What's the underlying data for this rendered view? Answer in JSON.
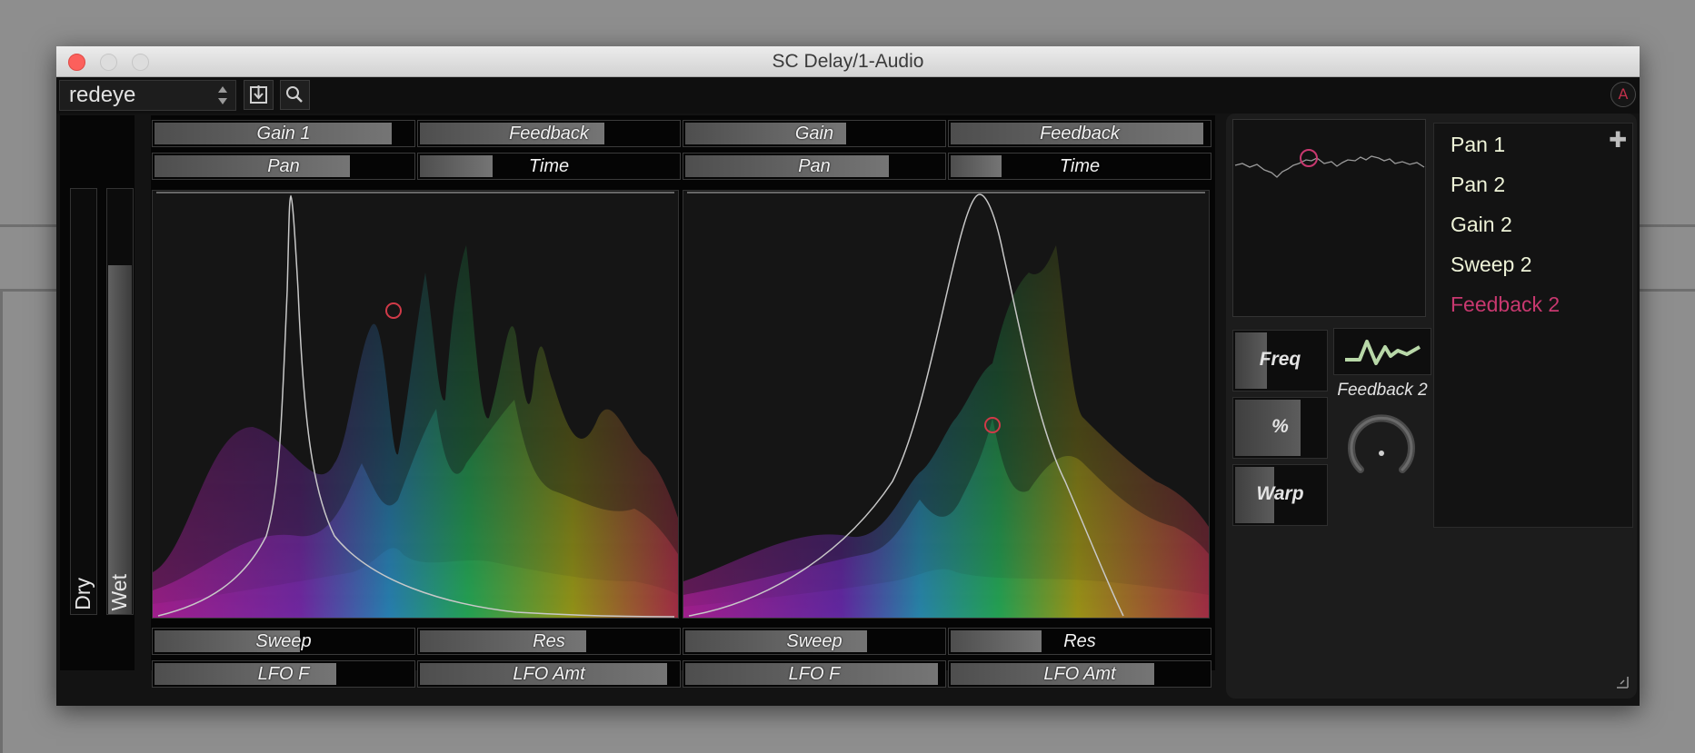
{
  "window": {
    "title": "SC Delay/1-Audio"
  },
  "toolbar": {
    "preset_name": "redeye",
    "user_badge": "A"
  },
  "dry_wet": {
    "dry": {
      "label": "Dry",
      "level": 0.0
    },
    "wet": {
      "label": "Wet",
      "level": 0.82
    }
  },
  "delay1": {
    "gain": {
      "label": "Gain 1",
      "level": 0.92
    },
    "feedback": {
      "label": "Feedback",
      "level": 0.72
    },
    "pan": {
      "label": "Pan",
      "level": 0.76
    },
    "time": {
      "label": "Time",
      "level": 0.29
    },
    "sweep": {
      "label": "Sweep",
      "level": 0.57
    },
    "res": {
      "label": "Res",
      "level": 0.65
    },
    "lfo_f": {
      "label": "LFO F",
      "level": 0.71
    },
    "lfo_amt": {
      "label": "LFO Amt",
      "level": 0.96
    }
  },
  "delay2": {
    "gain": {
      "label": "Gain",
      "level": 0.63
    },
    "feedback": {
      "label": "Feedback",
      "level": 0.98
    },
    "pan": {
      "label": "Pan",
      "level": 0.79
    },
    "time": {
      "label": "Time",
      "level": 0.21
    },
    "sweep": {
      "label": "Sweep",
      "level": 0.71
    },
    "res": {
      "label": "Res",
      "level": 0.36
    },
    "lfo_f": {
      "label": "LFO F",
      "level": 0.98
    },
    "lfo_amt": {
      "label": "LFO Amt",
      "level": 0.79
    }
  },
  "modulation": {
    "freq": {
      "label": "Freq",
      "level": 0.38
    },
    "percent": {
      "label": "%",
      "level": 0.74
    },
    "warp": {
      "label": "Warp",
      "level": 0.46
    },
    "target_label": "Feedback 2",
    "list": [
      {
        "label": "Pan 1",
        "color": "#eef3d8"
      },
      {
        "label": "Pan 2",
        "color": "#eef3d8"
      },
      {
        "label": "Gain 2",
        "color": "#eef3d8"
      },
      {
        "label": "Sweep 2",
        "color": "#eef3d8"
      },
      {
        "label": "Feedback 2",
        "color": "#c8386f"
      }
    ]
  },
  "colors": {
    "close": "#fc605c",
    "accent": "#c8386f",
    "list_text": "#eef3d8"
  }
}
